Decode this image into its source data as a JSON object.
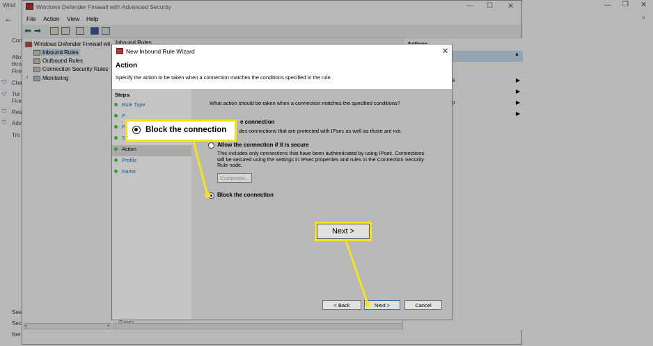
{
  "settings_bg": {
    "title_fragment": "Wind",
    "left_fragments": [
      "Con",
      "Allo",
      "thro",
      "Fire",
      "Cha",
      "Tur",
      "Fire",
      "Res",
      "Adv",
      "Tro",
      "See",
      "Sec",
      "Net"
    ]
  },
  "mmc": {
    "title": "Windows Defender Firewall with Advanced Security",
    "menu": [
      "File",
      "Action",
      "View",
      "Help"
    ],
    "tree": {
      "root": "Windows Defender Firewall wit",
      "items": [
        "Inbound Rules",
        "Outbound Rules",
        "Connection Security Rules",
        "Monitoring"
      ]
    },
    "center_header_fragment": "Inbound Rules",
    "actions_header": "Actions",
    "actions_fragments": [
      "e",
      "p"
    ],
    "bottom_row_fragment": "iTunes"
  },
  "wizard": {
    "title": "New Inbound Rule Wizard",
    "heading": "Action",
    "subheading": "Specify the action to be taken when a connection matches the conditions specified in the rule.",
    "steps_label": "Steps:",
    "steps": [
      "Rule Type",
      "P",
      "P",
      "S",
      "Action",
      "Profile",
      "Name"
    ],
    "question": "What action should be taken when a connection matches the specified conditions?",
    "options": [
      {
        "label": "e connection",
        "desc": "des connections that are protected with IPsec as well as those are not."
      },
      {
        "label": "Allow the connection if it is secure",
        "desc": "This includes only connections that have been authenticated by using IPsec. Connections will be secured using the settings in IPsec properties and rules in the Connection Security Rule node."
      },
      {
        "label": "Block the connection",
        "desc": ""
      }
    ],
    "customize_label": "Customize...",
    "back_label": "< Back",
    "next_label": "Next >",
    "cancel_label": "Cancel"
  },
  "callouts": {
    "block_label": "Block the connection",
    "next_label": "Next >"
  },
  "colors": {
    "highlight": "#f7e21c"
  }
}
